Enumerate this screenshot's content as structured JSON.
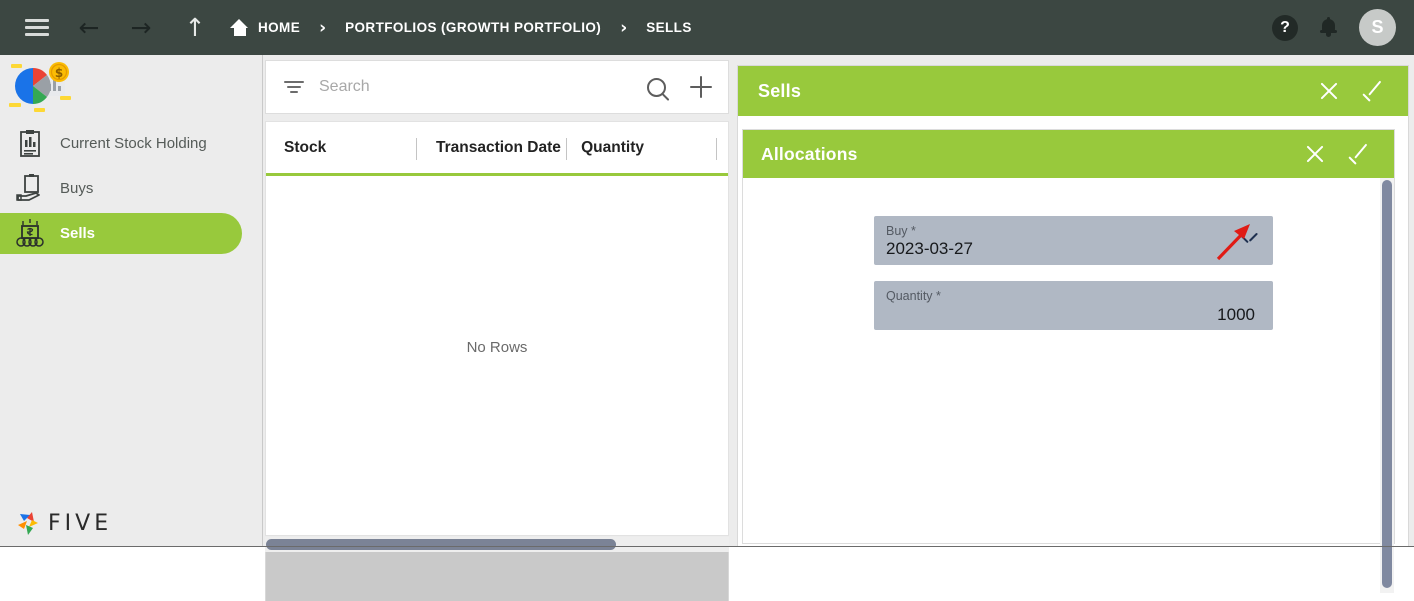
{
  "topbar": {
    "menu_icon": "hamburger-icon",
    "back_icon": "arrow-left-icon",
    "forward_icon": "arrow-right-icon",
    "up_icon": "arrow-up-icon",
    "home_icon": "home-icon",
    "breadcrumb": [
      {
        "label": "HOME"
      },
      {
        "label": "PORTFOLIOS (GROWTH PORTFOLIO)"
      },
      {
        "label": "SELLS"
      }
    ],
    "separator": "›",
    "help_label": "?",
    "help_icon": "help-circle-icon",
    "bell_icon": "notification-bell-icon",
    "avatar_initial": "S",
    "bg_color": "#3c4742"
  },
  "sidebar": {
    "logo_icon": "portfolio-pie-chart-logo",
    "items": [
      {
        "label": "Current Stock Holding",
        "icon": "clipboard-chart-icon",
        "active": false
      },
      {
        "label": "Buys",
        "icon": "clipboard-hand-icon",
        "active": false
      },
      {
        "label": "Sells",
        "icon": "money-stack-icon",
        "active": true
      }
    ],
    "brand": "FIVE",
    "brand_icon": "five-pinwheel-logo",
    "active_color": "#98c93c"
  },
  "list_panel": {
    "search": {
      "placeholder": "Search",
      "value": "",
      "filter_icon": "filter-icon",
      "search_icon": "search-icon",
      "add_icon": "plus-icon"
    },
    "table": {
      "columns": [
        "Stock",
        "Transaction Date",
        "Quantity"
      ],
      "rows": [],
      "empty_text": "No Rows"
    },
    "accent_color": "#98c93c"
  },
  "form_panel": {
    "sells": {
      "title": "Sells",
      "close_label": "close-form",
      "confirm_label": "save-form"
    },
    "allocations": {
      "title": "Allocations",
      "close_label": "close-allocations",
      "confirm_label": "save-allocations",
      "fields": [
        {
          "label": "Buy *",
          "value": "2023-03-27",
          "type": "dropdown",
          "icon": "chevron-down-icon",
          "align": "left"
        },
        {
          "label": "Quantity *",
          "value": "1000",
          "type": "number",
          "align": "right"
        }
      ]
    },
    "annotation": {
      "type": "red-arrow",
      "color": "#e01b15",
      "points_to": "buy-dropdown-chevron"
    },
    "header_color": "#98c93c",
    "field_color": "#b0b8c4"
  }
}
